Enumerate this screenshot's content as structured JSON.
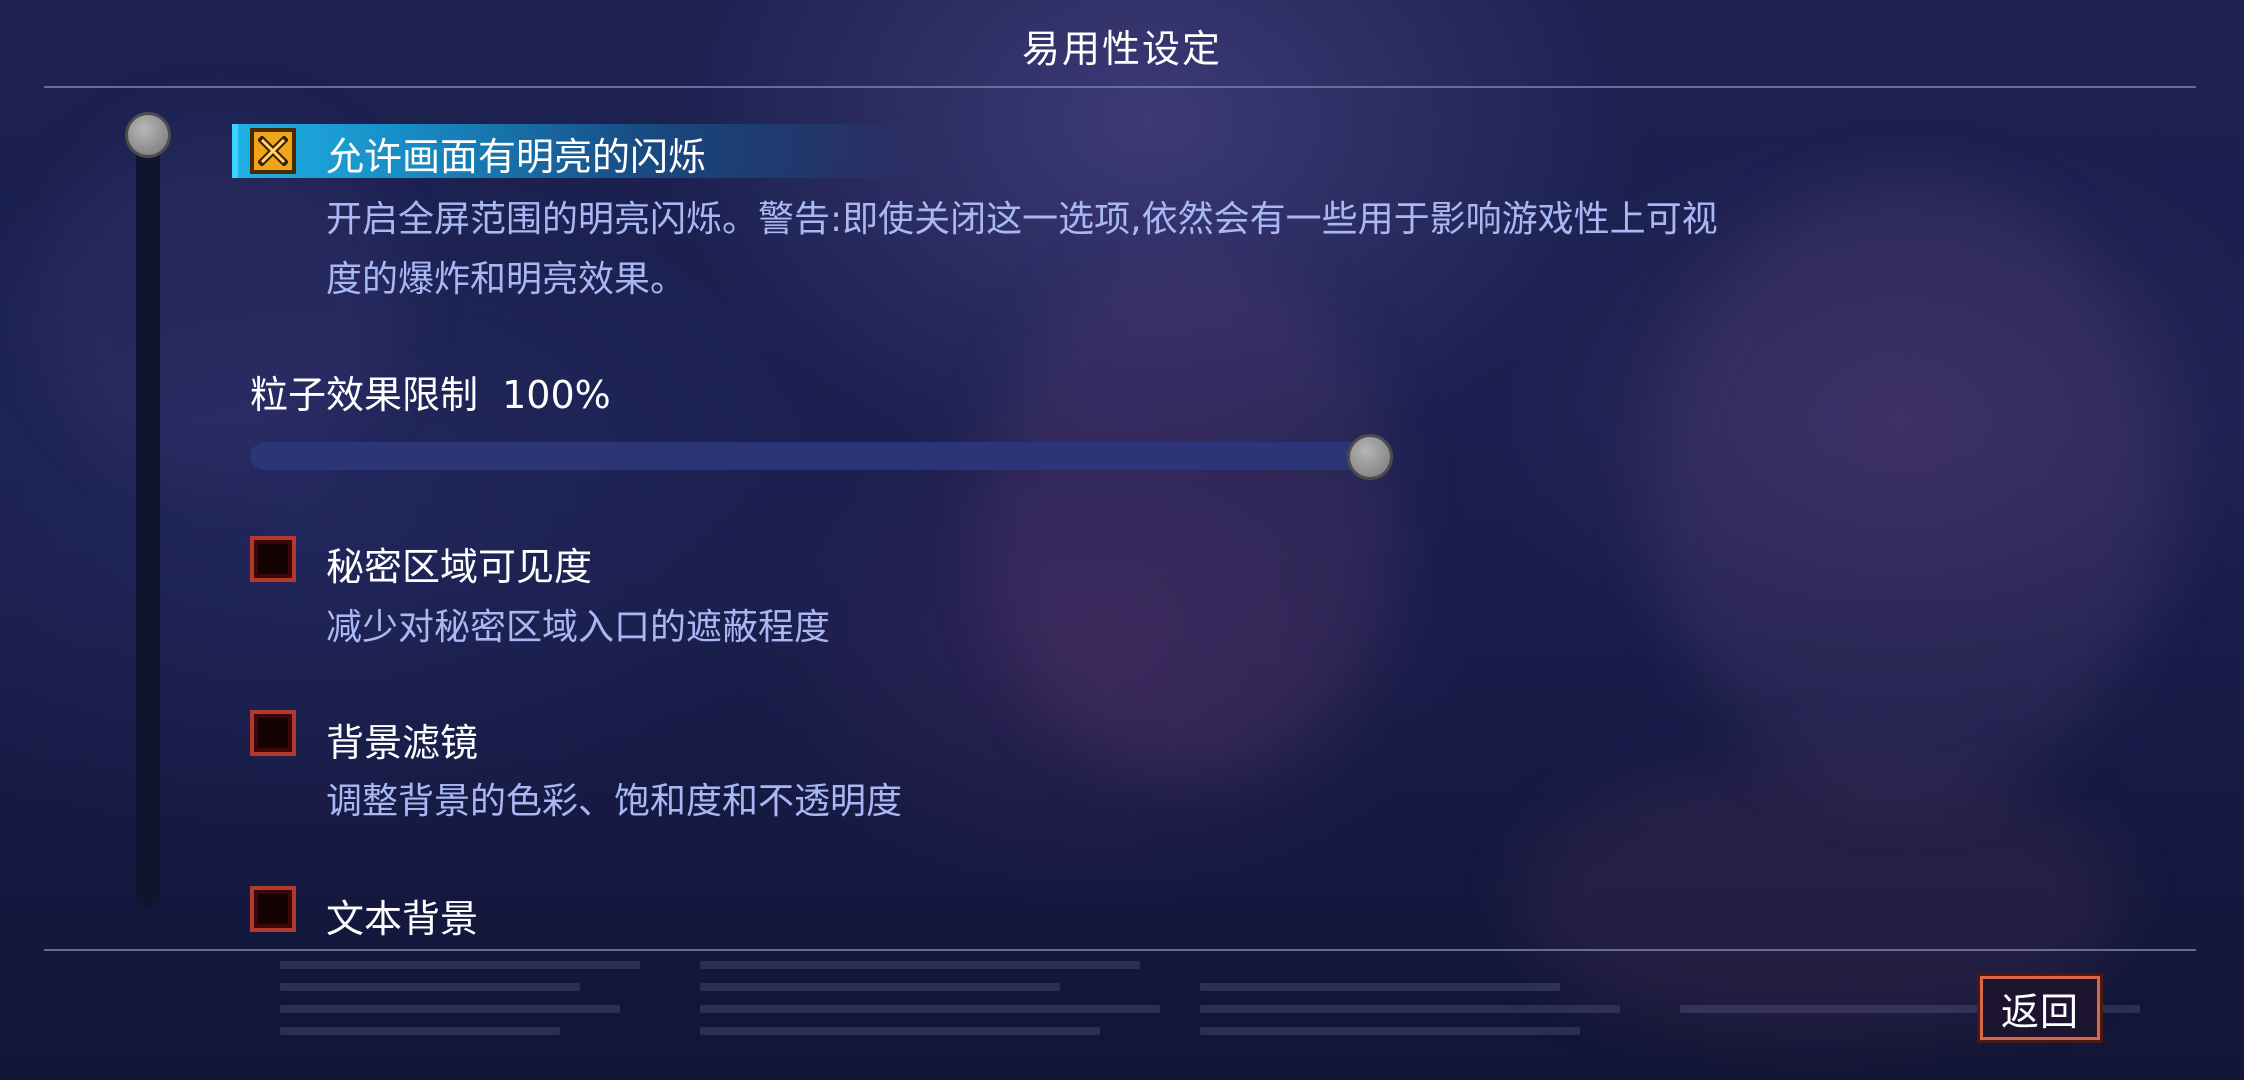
{
  "header": {
    "title": "易用性设定"
  },
  "options": [
    {
      "title": "允许画面有明亮的闪烁",
      "checked": true,
      "highlighted": true,
      "desc_line1": "开启全屏范围的明亮闪烁。警告:即使关闭这一选项,依然会有一些用于影响游戏性上可视",
      "desc_line2": "度的爆炸和明亮效果。"
    },
    {
      "title": "秘密区域可见度",
      "checked": false,
      "desc_line1": "减少对秘密区域入口的遮蔽程度"
    },
    {
      "title": "背景滤镜",
      "checked": false,
      "desc_line1": "调整背景的色彩、饱和度和不透明度"
    },
    {
      "title": "文本背景",
      "checked": false
    }
  ],
  "particle_slider": {
    "label": "粒子效果限制",
    "value_text": "100%",
    "value": 1.0
  },
  "footer": {
    "back_label": "返回"
  },
  "icons": {
    "checked": "x-mark-icon",
    "scroll": "scroll-thumb",
    "slider": "slider-knob"
  },
  "colors": {
    "accent_highlight": "#1fb2e4",
    "checkbox_on": "#f0a419",
    "checkbox_off_border": "#b33a2a",
    "desc_text": "#a9b7f4"
  }
}
